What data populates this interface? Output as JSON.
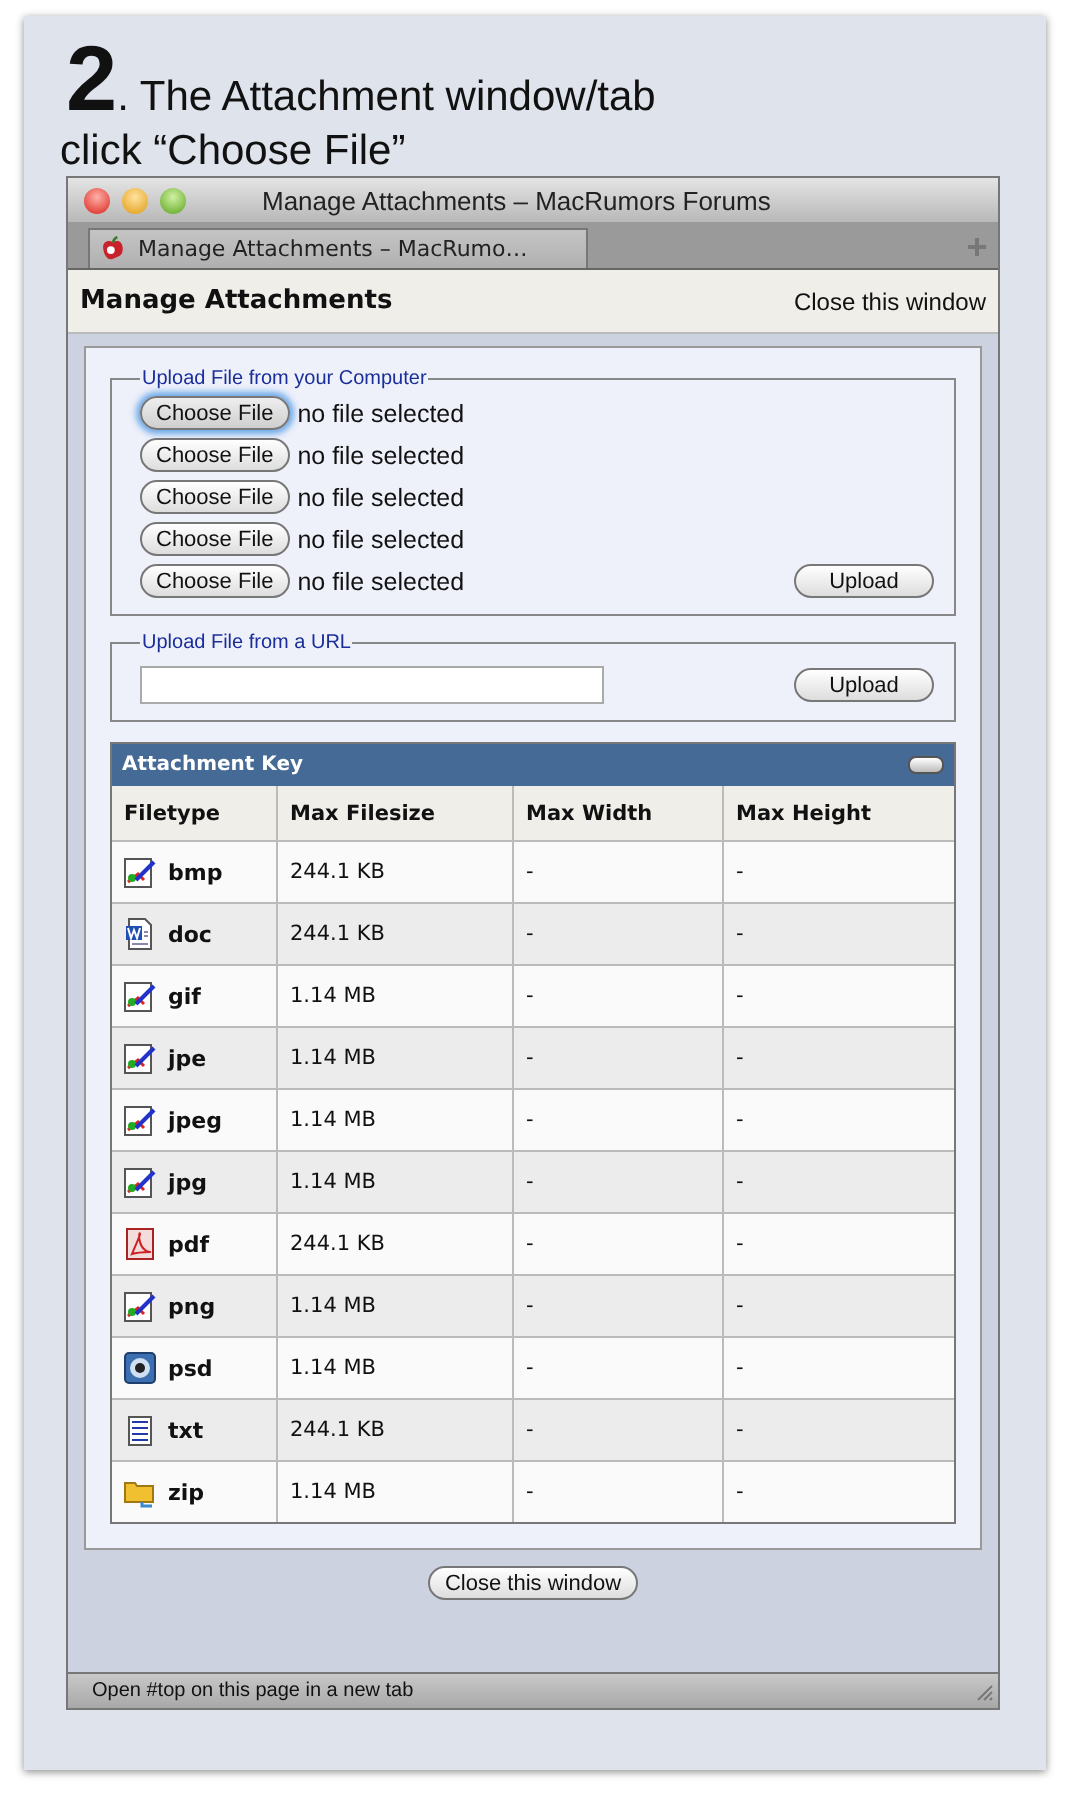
{
  "caption": {
    "step": "2",
    "title": ". The Attachment window/tab",
    "instruction": "click “Choose File”"
  },
  "window": {
    "title": "Manage Attachments – MacRumors Forums"
  },
  "tabs": [
    {
      "label": "Manage Attachments – MacRumo…",
      "selected": true
    }
  ],
  "page": {
    "heading": "Manage Attachments",
    "close_link": "Close this window"
  },
  "upload_computer": {
    "legend": "Upload File from your Computer",
    "upload_button": "Upload",
    "files": [
      {
        "button": "Choose File",
        "status": "no file selected",
        "focused": true
      },
      {
        "button": "Choose File",
        "status": "no file selected",
        "focused": false
      },
      {
        "button": "Choose File",
        "status": "no file selected",
        "focused": false
      },
      {
        "button": "Choose File",
        "status": "no file selected",
        "focused": false
      },
      {
        "button": "Choose File",
        "status": "no file selected",
        "focused": false
      }
    ]
  },
  "upload_url": {
    "legend": "Upload File from a URL",
    "upload_button": "Upload"
  },
  "attachment_key": {
    "title": "Attachment Key",
    "columns": [
      "Filetype",
      "Max Filesize",
      "Max Width",
      "Max Height"
    ],
    "rows": [
      {
        "kind": "image",
        "filetype": "bmp",
        "max_filesize": "244.1 KB",
        "max_width": "-",
        "max_height": "-"
      },
      {
        "kind": "word",
        "filetype": "doc",
        "max_filesize": "244.1 KB",
        "max_width": "-",
        "max_height": "-"
      },
      {
        "kind": "image",
        "filetype": "gif",
        "max_filesize": "1.14 MB",
        "max_width": "-",
        "max_height": "-"
      },
      {
        "kind": "image",
        "filetype": "jpe",
        "max_filesize": "1.14 MB",
        "max_width": "-",
        "max_height": "-"
      },
      {
        "kind": "image",
        "filetype": "jpeg",
        "max_filesize": "1.14 MB",
        "max_width": "-",
        "max_height": "-"
      },
      {
        "kind": "image",
        "filetype": "jpg",
        "max_filesize": "1.14 MB",
        "max_width": "-",
        "max_height": "-"
      },
      {
        "kind": "pdf",
        "filetype": "pdf",
        "max_filesize": "244.1 KB",
        "max_width": "-",
        "max_height": "-"
      },
      {
        "kind": "image",
        "filetype": "png",
        "max_filesize": "1.14 MB",
        "max_width": "-",
        "max_height": "-"
      },
      {
        "kind": "photoshop",
        "filetype": "psd",
        "max_filesize": "1.14 MB",
        "max_width": "-",
        "max_height": "-"
      },
      {
        "kind": "text",
        "filetype": "txt",
        "max_filesize": "244.1 KB",
        "max_width": "-",
        "max_height": "-"
      },
      {
        "kind": "archive",
        "filetype": "zip",
        "max_filesize": "1.14 MB",
        "max_width": "-",
        "max_height": "-"
      }
    ]
  },
  "close_button": "Close this window",
  "status_bar": "Open #top on this page in a new tab"
}
